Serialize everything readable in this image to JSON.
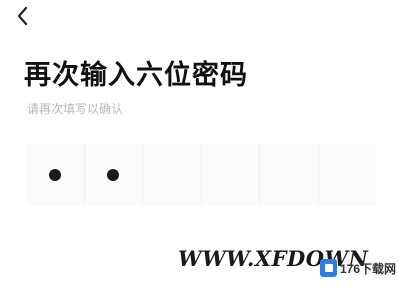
{
  "header": {
    "back_icon": "chevron-left-icon"
  },
  "main": {
    "title": "再次输入六位密码",
    "subtitle": "请再次填写以确认"
  },
  "pin": {
    "length": 6,
    "filled": 2
  },
  "watermark": {
    "text": "WWW.XFDOWN",
    "logo_text": "176下载网",
    "logo_color": "#2f7fe0"
  }
}
